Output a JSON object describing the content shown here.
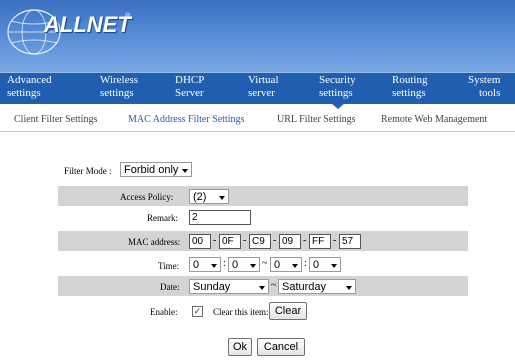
{
  "brand": {
    "name": "ALLNET",
    "reg": "®"
  },
  "nav": [
    {
      "l1": "Advanced",
      "l2": "settings"
    },
    {
      "l1": "Wireless",
      "l2": "settings"
    },
    {
      "l1": "DHCP",
      "l2": "Server"
    },
    {
      "l1": "Virtual",
      "l2": "server"
    },
    {
      "l1": "Security",
      "l2": "settings"
    },
    {
      "l1": "Routing",
      "l2": "settings"
    },
    {
      "l1": "System",
      "l2": "tools"
    }
  ],
  "active_nav": "Security settings",
  "subnav": [
    "Client Filter Settings",
    "MAC Address Filter Settings",
    "URL Filter Settings",
    "Remote Web Management"
  ],
  "active_subnav": "MAC Address Filter Settings",
  "form": {
    "filter_mode_label": "Filter Mode :",
    "filter_mode_value": "Forbid only",
    "access_policy_label": "Access Policy:",
    "access_policy_value": "(2)",
    "remark_label": "Remark:",
    "remark_value": "2",
    "mac_label": "MAC address:",
    "mac": [
      "00",
      "0F",
      "C9",
      "09",
      "FF",
      "57"
    ],
    "mac_sep": "-",
    "time_label": "Time:",
    "time": [
      "0",
      "0",
      "0",
      "0"
    ],
    "time_sep_colon": ":",
    "range_sep": "~",
    "date_label": "Date:",
    "date_from": "Sunday",
    "date_to": "Saturday",
    "enable_label": "Enable:",
    "enable_check": "✓",
    "clear_item_label": "Clear this item:",
    "clear_button": "Clear",
    "ok_button": "Ok",
    "cancel_button": "Cancel"
  },
  "colors": {
    "header": "#3a6fc0",
    "nav": "#1f5eb0",
    "row_shade": "#d4d4d4",
    "active_sub": "#1f5eb0"
  }
}
